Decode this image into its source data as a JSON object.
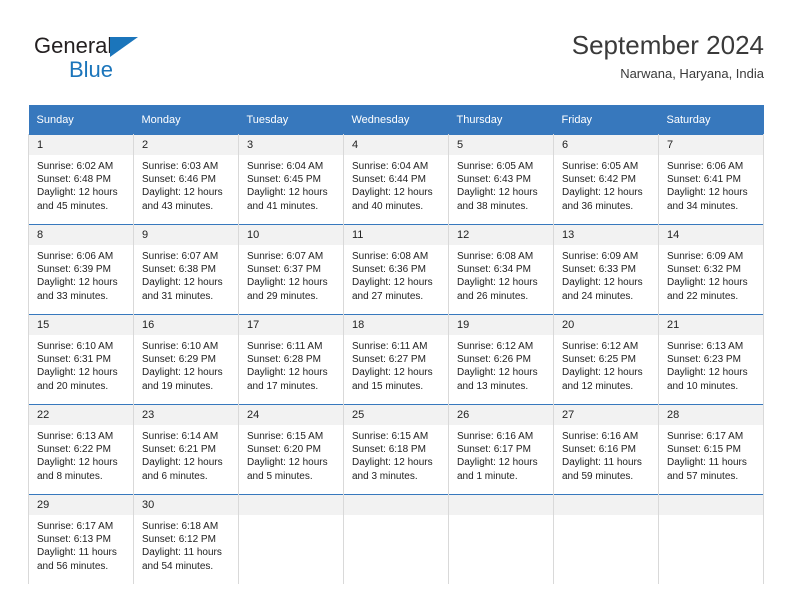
{
  "brand": {
    "name_part1": "General",
    "name_part2": "Blue"
  },
  "header": {
    "title": "September 2024",
    "subtitle": "Narwana, Haryana, India"
  },
  "colors": {
    "header_blue": "#3778bd",
    "brand_blue": "#1b75bb",
    "daynum_bg": "#f2f2f2",
    "cell_border": "#d9d9d9"
  },
  "weekdays": [
    "Sunday",
    "Monday",
    "Tuesday",
    "Wednesday",
    "Thursday",
    "Friday",
    "Saturday"
  ],
  "weeks": [
    [
      {
        "day": "1",
        "sunrise": "Sunrise: 6:02 AM",
        "sunset": "Sunset: 6:48 PM",
        "daylight1": "Daylight: 12 hours",
        "daylight2": "and 45 minutes."
      },
      {
        "day": "2",
        "sunrise": "Sunrise: 6:03 AM",
        "sunset": "Sunset: 6:46 PM",
        "daylight1": "Daylight: 12 hours",
        "daylight2": "and 43 minutes."
      },
      {
        "day": "3",
        "sunrise": "Sunrise: 6:04 AM",
        "sunset": "Sunset: 6:45 PM",
        "daylight1": "Daylight: 12 hours",
        "daylight2": "and 41 minutes."
      },
      {
        "day": "4",
        "sunrise": "Sunrise: 6:04 AM",
        "sunset": "Sunset: 6:44 PM",
        "daylight1": "Daylight: 12 hours",
        "daylight2": "and 40 minutes."
      },
      {
        "day": "5",
        "sunrise": "Sunrise: 6:05 AM",
        "sunset": "Sunset: 6:43 PM",
        "daylight1": "Daylight: 12 hours",
        "daylight2": "and 38 minutes."
      },
      {
        "day": "6",
        "sunrise": "Sunrise: 6:05 AM",
        "sunset": "Sunset: 6:42 PM",
        "daylight1": "Daylight: 12 hours",
        "daylight2": "and 36 minutes."
      },
      {
        "day": "7",
        "sunrise": "Sunrise: 6:06 AM",
        "sunset": "Sunset: 6:41 PM",
        "daylight1": "Daylight: 12 hours",
        "daylight2": "and 34 minutes."
      }
    ],
    [
      {
        "day": "8",
        "sunrise": "Sunrise: 6:06 AM",
        "sunset": "Sunset: 6:39 PM",
        "daylight1": "Daylight: 12 hours",
        "daylight2": "and 33 minutes."
      },
      {
        "day": "9",
        "sunrise": "Sunrise: 6:07 AM",
        "sunset": "Sunset: 6:38 PM",
        "daylight1": "Daylight: 12 hours",
        "daylight2": "and 31 minutes."
      },
      {
        "day": "10",
        "sunrise": "Sunrise: 6:07 AM",
        "sunset": "Sunset: 6:37 PM",
        "daylight1": "Daylight: 12 hours",
        "daylight2": "and 29 minutes."
      },
      {
        "day": "11",
        "sunrise": "Sunrise: 6:08 AM",
        "sunset": "Sunset: 6:36 PM",
        "daylight1": "Daylight: 12 hours",
        "daylight2": "and 27 minutes."
      },
      {
        "day": "12",
        "sunrise": "Sunrise: 6:08 AM",
        "sunset": "Sunset: 6:34 PM",
        "daylight1": "Daylight: 12 hours",
        "daylight2": "and 26 minutes."
      },
      {
        "day": "13",
        "sunrise": "Sunrise: 6:09 AM",
        "sunset": "Sunset: 6:33 PM",
        "daylight1": "Daylight: 12 hours",
        "daylight2": "and 24 minutes."
      },
      {
        "day": "14",
        "sunrise": "Sunrise: 6:09 AM",
        "sunset": "Sunset: 6:32 PM",
        "daylight1": "Daylight: 12 hours",
        "daylight2": "and 22 minutes."
      }
    ],
    [
      {
        "day": "15",
        "sunrise": "Sunrise: 6:10 AM",
        "sunset": "Sunset: 6:31 PM",
        "daylight1": "Daylight: 12 hours",
        "daylight2": "and 20 minutes."
      },
      {
        "day": "16",
        "sunrise": "Sunrise: 6:10 AM",
        "sunset": "Sunset: 6:29 PM",
        "daylight1": "Daylight: 12 hours",
        "daylight2": "and 19 minutes."
      },
      {
        "day": "17",
        "sunrise": "Sunrise: 6:11 AM",
        "sunset": "Sunset: 6:28 PM",
        "daylight1": "Daylight: 12 hours",
        "daylight2": "and 17 minutes."
      },
      {
        "day": "18",
        "sunrise": "Sunrise: 6:11 AM",
        "sunset": "Sunset: 6:27 PM",
        "daylight1": "Daylight: 12 hours",
        "daylight2": "and 15 minutes."
      },
      {
        "day": "19",
        "sunrise": "Sunrise: 6:12 AM",
        "sunset": "Sunset: 6:26 PM",
        "daylight1": "Daylight: 12 hours",
        "daylight2": "and 13 minutes."
      },
      {
        "day": "20",
        "sunrise": "Sunrise: 6:12 AM",
        "sunset": "Sunset: 6:25 PM",
        "daylight1": "Daylight: 12 hours",
        "daylight2": "and 12 minutes."
      },
      {
        "day": "21",
        "sunrise": "Sunrise: 6:13 AM",
        "sunset": "Sunset: 6:23 PM",
        "daylight1": "Daylight: 12 hours",
        "daylight2": "and 10 minutes."
      }
    ],
    [
      {
        "day": "22",
        "sunrise": "Sunrise: 6:13 AM",
        "sunset": "Sunset: 6:22 PM",
        "daylight1": "Daylight: 12 hours",
        "daylight2": "and 8 minutes."
      },
      {
        "day": "23",
        "sunrise": "Sunrise: 6:14 AM",
        "sunset": "Sunset: 6:21 PM",
        "daylight1": "Daylight: 12 hours",
        "daylight2": "and 6 minutes."
      },
      {
        "day": "24",
        "sunrise": "Sunrise: 6:15 AM",
        "sunset": "Sunset: 6:20 PM",
        "daylight1": "Daylight: 12 hours",
        "daylight2": "and 5 minutes."
      },
      {
        "day": "25",
        "sunrise": "Sunrise: 6:15 AM",
        "sunset": "Sunset: 6:18 PM",
        "daylight1": "Daylight: 12 hours",
        "daylight2": "and 3 minutes."
      },
      {
        "day": "26",
        "sunrise": "Sunrise: 6:16 AM",
        "sunset": "Sunset: 6:17 PM",
        "daylight1": "Daylight: 12 hours",
        "daylight2": "and 1 minute."
      },
      {
        "day": "27",
        "sunrise": "Sunrise: 6:16 AM",
        "sunset": "Sunset: 6:16 PM",
        "daylight1": "Daylight: 11 hours",
        "daylight2": "and 59 minutes."
      },
      {
        "day": "28",
        "sunrise": "Sunrise: 6:17 AM",
        "sunset": "Sunset: 6:15 PM",
        "daylight1": "Daylight: 11 hours",
        "daylight2": "and 57 minutes."
      }
    ],
    [
      {
        "day": "29",
        "sunrise": "Sunrise: 6:17 AM",
        "sunset": "Sunset: 6:13 PM",
        "daylight1": "Daylight: 11 hours",
        "daylight2": "and 56 minutes."
      },
      {
        "day": "30",
        "sunrise": "Sunrise: 6:18 AM",
        "sunset": "Sunset: 6:12 PM",
        "daylight1": "Daylight: 11 hours",
        "daylight2": "and 54 minutes."
      },
      {
        "day": "",
        "sunrise": "",
        "sunset": "",
        "daylight1": "",
        "daylight2": ""
      },
      {
        "day": "",
        "sunrise": "",
        "sunset": "",
        "daylight1": "",
        "daylight2": ""
      },
      {
        "day": "",
        "sunrise": "",
        "sunset": "",
        "daylight1": "",
        "daylight2": ""
      },
      {
        "day": "",
        "sunrise": "",
        "sunset": "",
        "daylight1": "",
        "daylight2": ""
      },
      {
        "day": "",
        "sunrise": "",
        "sunset": "",
        "daylight1": "",
        "daylight2": ""
      }
    ]
  ]
}
